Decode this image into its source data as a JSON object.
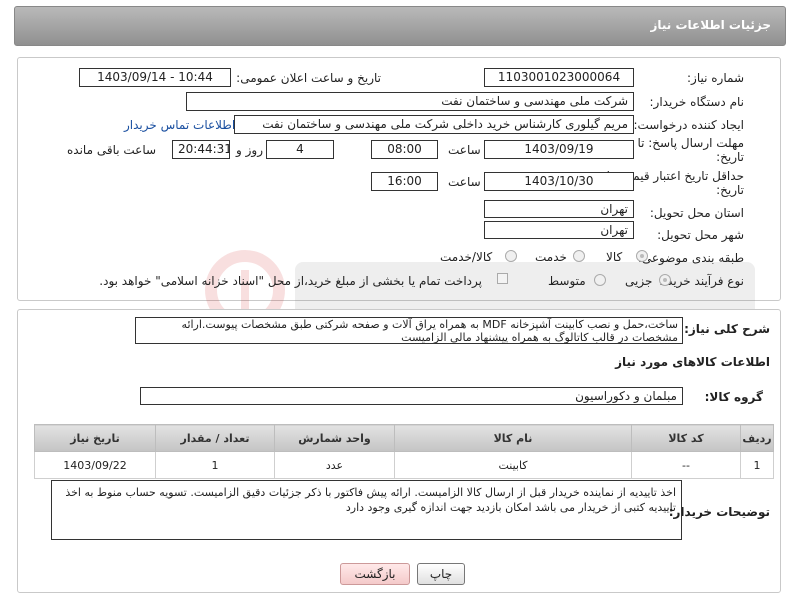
{
  "header": {
    "title": "جزئیات اطلاعات نیاز"
  },
  "form": {
    "need_number_label": "شماره نیاز:",
    "need_number": "1103001023000064",
    "announce_label": "تاریخ و ساعت اعلان عمومی:",
    "announce_value": "1403/09/14 - 10:44",
    "buyer_label": "نام دستگاه خریدار:",
    "buyer_value": "شرکت ملی مهندسی و ساختمان نفت",
    "creator_label": "ایجاد کننده درخواست:",
    "creator_value": "مریم گیلوری کارشناس خرید داخلی شرکت ملی مهندسی و ساختمان نفت",
    "contact_link": "اطلاعات تماس خریدار",
    "deadline_label_1": "مهلت ارسال پاسخ: تا",
    "deadline_label_2": "تاریخ:",
    "deadline_date": "1403/09/19",
    "time_label": "ساعت",
    "deadline_time": "08:00",
    "days_value": "4",
    "days_label": "روز و",
    "remaining_time": "20:44:31",
    "remaining_label": "ساعت باقی مانده",
    "validity_label_1": "حداقل تاریخ اعتبار قیمت: تا",
    "validity_label_2": "تاریخ:",
    "validity_date": "1403/10/30",
    "validity_time": "16:00",
    "province_label": "استان محل تحویل:",
    "province_value": "تهران",
    "city_label": "شهر محل تحویل:",
    "city_value": "تهران",
    "category_label": "طبقه بندی موضوعی:",
    "category_options": [
      "کالا",
      "خدمت",
      "کالا/خدمت"
    ],
    "process_label": "نوع فرآیند خرید :",
    "process_options": [
      "جزیی",
      "متوسط"
    ],
    "payment_text": "پرداخت تمام یا بخشی از مبلغ خرید،از محل \"اسناد خزانه اسلامی\" خواهد بود.",
    "summary_label": "شرح کلی نیاز:",
    "summary_text": "ساخت،حمل و نصب کابینت آشپزخانه MDF به همراه یراق آلات و صفحه شرکتی طبق مشخصات پیوست.ارائه مشخصات در قالب کاتالوگ به همراه پیشنهاد مالی الزامیست",
    "goods_info_title": "اطلاعات کالاهای مورد نیاز",
    "goods_group_label": "گروه کالا:",
    "goods_group_value": "مبلمان و دکوراسیون"
  },
  "table": {
    "headers": [
      "ردیف",
      "کد کالا",
      "نام کالا",
      "واحد شمارش",
      "تعداد / مقدار",
      "تاریخ نیاز"
    ],
    "rows": [
      [
        "1",
        "--",
        "کابینت",
        "عدد",
        "1",
        "1403/09/22"
      ]
    ]
  },
  "notes": {
    "label": "توضیحات خریدار:",
    "text": "اخذ تاییدیه از نماینده خریدار قبل از ارسال کالا الزامیست. ارائه پیش فاکتور با ذکر جزئیات دقیق الزامیست. تسویه حساب منوط به اخذ تاییدیه کتبی از خریدار می باشد امکان بازدید جهت اندازه گیری وجود دارد"
  },
  "buttons": {
    "print": "چاپ",
    "back": "بازگشت"
  }
}
